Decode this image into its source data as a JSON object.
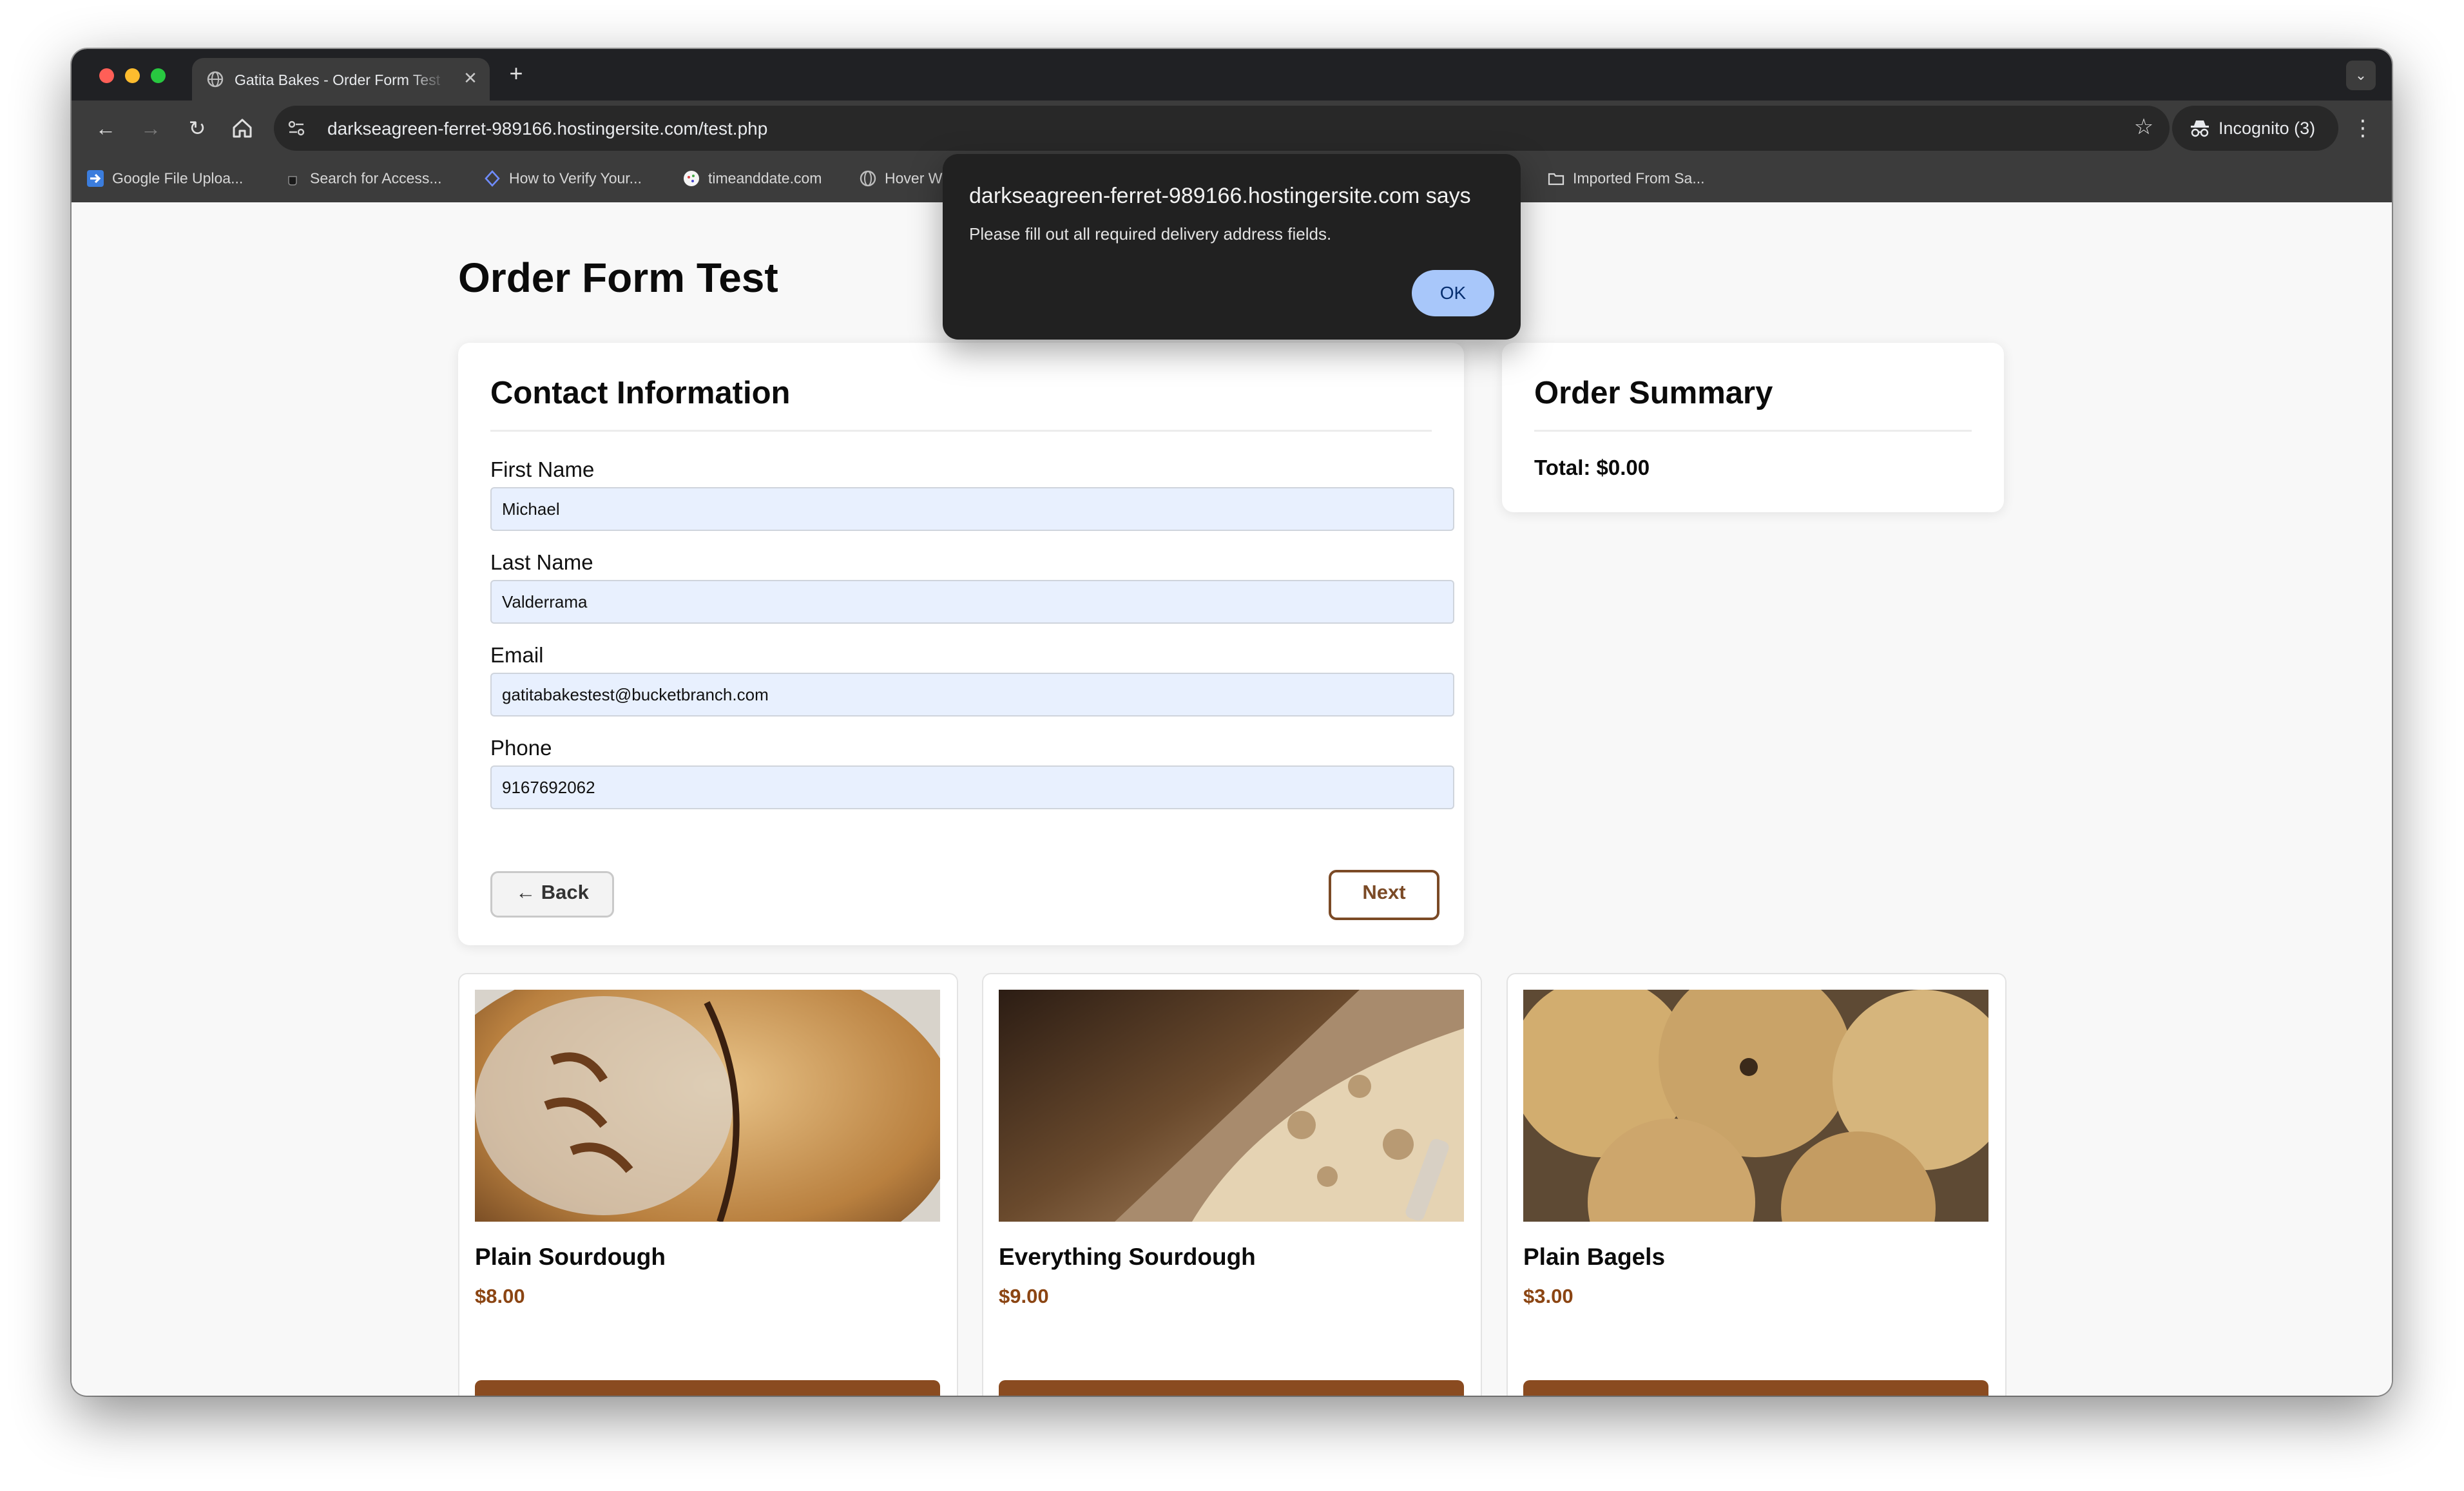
{
  "browser": {
    "tab_title": "Gatita Bakes - Order Form Test",
    "tab_close": "✕",
    "new_tab": "+",
    "url": "darkseagreen-ferret-989166.hostingersite.com/test.php",
    "incognito_label": "Incognito (3)",
    "bookmarks": [
      {
        "label": "Google File Uploa...",
        "icon": "arrow-right-icon"
      },
      {
        "label": "Search for Access...",
        "icon": "coffee-cup-icon"
      },
      {
        "label": "How to Verify Your...",
        "icon": "shield-icon"
      },
      {
        "label": "timeanddate.com",
        "icon": "clock-icon"
      },
      {
        "label": "Hover W",
        "icon": "globe-icon"
      },
      {
        "label": "Imported From Sa...",
        "icon": "folder-icon"
      }
    ]
  },
  "page": {
    "title": "Order Form Test"
  },
  "contact": {
    "heading": "Contact Information",
    "fields": [
      {
        "label": "First Name",
        "value": "Michael"
      },
      {
        "label": "Last Name",
        "value": "Valderrama"
      },
      {
        "label": "Email",
        "value": "gatitabakestest@bucketbranch.com"
      },
      {
        "label": "Phone",
        "value": "9167692062"
      }
    ],
    "back_label": "← Back",
    "next_label": "Next"
  },
  "summary": {
    "heading": "Order Summary",
    "total": "Total: $0.00"
  },
  "products": [
    {
      "name": "Plain Sourdough",
      "price": "$8.00"
    },
    {
      "name": "Everything Sourdough",
      "price": "$9.00"
    },
    {
      "name": "Plain Bagels",
      "price": "$3.00"
    }
  ],
  "dialog": {
    "title": "darkseagreen-ferret-989166.hostingersite.com says",
    "message": "Please fill out all required delivery address fields.",
    "ok_label": "OK"
  },
  "colors": {
    "brand_brown": "#7b4a26",
    "price_brown": "#8b4513",
    "autofill_blue": "#e8f0fe",
    "dialog_button": "#a8c7fa"
  }
}
